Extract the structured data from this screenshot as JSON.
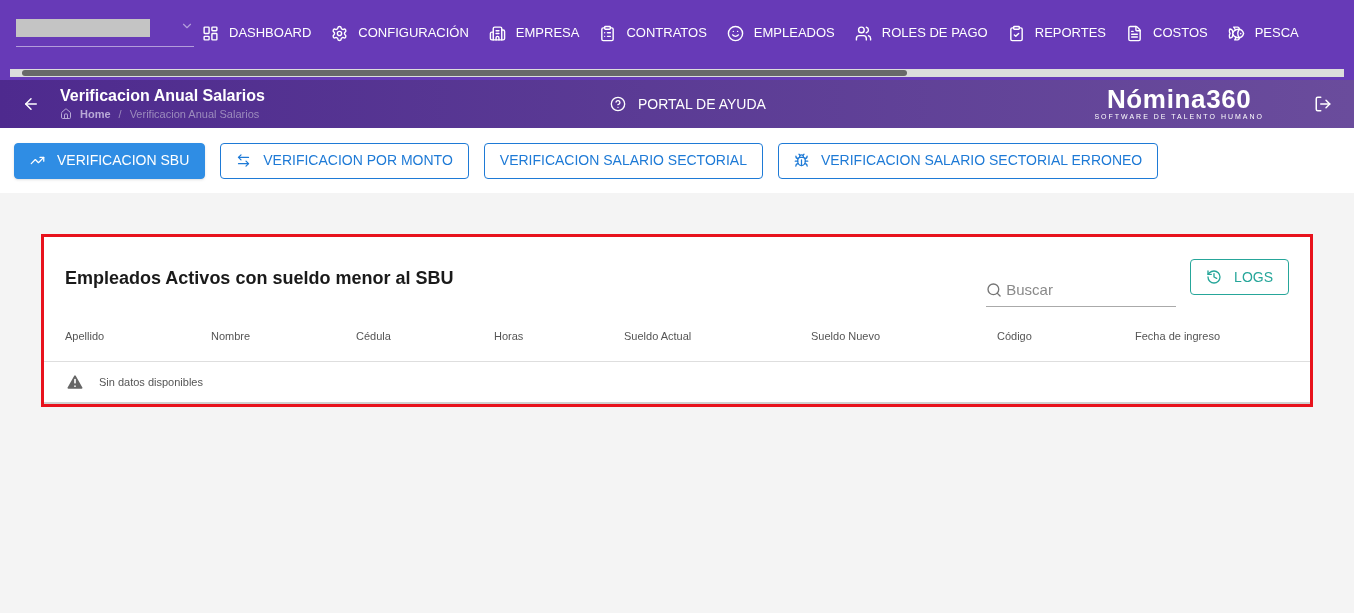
{
  "nav": {
    "items": [
      "DASHBOARD",
      "CONFIGURACIÓN",
      "EMPRESA",
      "CONTRATOS",
      "EMPLEADOS",
      "ROLES DE PAGO",
      "REPORTES",
      "COSTOS",
      "PESCA"
    ]
  },
  "header": {
    "title": "Verificacion Anual Salarios",
    "breadcrumb": [
      "Home",
      "/",
      "Verificacion Anual Salarios"
    ],
    "help": "PORTAL DE AYUDA",
    "logo": "Nómina360",
    "logo_tagline": "SOFTWARE DE TALENTO HUMANO"
  },
  "tabs": [
    {
      "label": "VERIFICACION SBU",
      "selected": true
    },
    {
      "label": "VERIFICACION POR MONTO",
      "selected": false
    },
    {
      "label": "VERIFICACION SALARIO SECTORIAL",
      "selected": false
    },
    {
      "label": "VERIFICACION SALARIO SECTORIAL ERRONEO",
      "selected": false
    }
  ],
  "card": {
    "title": "Empleados Activos con sueldo menor al SBU",
    "search": {
      "placeholder": "Buscar"
    },
    "logs_button": "LOGS",
    "table": {
      "columns": [
        "Apellido",
        "Nombre",
        "Cédula",
        "Horas",
        "Sueldo Actual",
        "Sueldo Nuevo",
        "Código",
        "Fecha de ingreso"
      ],
      "empty": "Sin datos disponibles"
    }
  }
}
